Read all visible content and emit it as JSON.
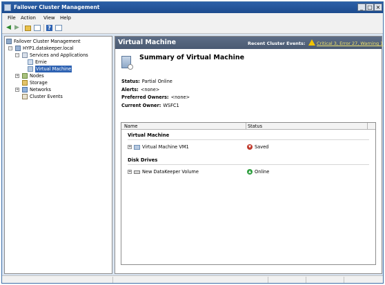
{
  "window": {
    "title": "Failover Cluster Management"
  },
  "titlebar_buttons": {
    "minimize": "_",
    "maximize": "□",
    "close": "×"
  },
  "menu": {
    "file": "File",
    "action": "Action",
    "view": "View",
    "help": "Help"
  },
  "toolbar": {
    "back_icon": "arrow-left-icon",
    "forward_icon": "arrow-right-icon",
    "up_icon": "folder-up-icon",
    "console_icon": "console-tree-icon",
    "help_icon": "help-icon",
    "help_glyph": "?",
    "panel_icon": "action-pane-icon"
  },
  "tree": {
    "root": "Failover Cluster Management",
    "cluster": "HYP1.datakeeper.local",
    "services": "Services and Applications",
    "ernie": "Ernie",
    "virtual_machine": "Virtual Machine",
    "nodes": "Nodes",
    "storage": "Storage",
    "networks": "Networks",
    "cluster_events": "Cluster Events",
    "expand_glyph": "+",
    "collapse_glyph": "−"
  },
  "pane": {
    "title": "Virtual Machine",
    "events_label": "Recent Cluster Events:",
    "events_link": "Critical 3, Error 27, Warning 1",
    "summary_title": "Summary of Virtual Machine",
    "properties": {
      "status_label": "Status:",
      "status_value": "Partial Online",
      "alerts_label": "Alerts:",
      "alerts_value": "<none>",
      "preferred_owners_label": "Preferred Owners:",
      "preferred_owners_value": "<none>",
      "current_owner_label": "Current Owner:",
      "current_owner_value": "WSFC1"
    },
    "grid": {
      "columns": [
        "Name",
        "Status"
      ],
      "groups": [
        {
          "title": "Virtual Machine",
          "rows": [
            {
              "name": "Virtual Machine VM1",
              "status": "Saved"
            }
          ]
        },
        {
          "title": "Disk Drives",
          "rows": [
            {
              "name": "New DataKeeper Volume",
              "status": "Online"
            }
          ]
        }
      ]
    }
  },
  "colors": {
    "title_bar": "#2b5fa7",
    "header_bar": "#5d6d86",
    "selection": "#2f63b3",
    "saved": "#c0392b",
    "online": "#2e9e3e"
  }
}
